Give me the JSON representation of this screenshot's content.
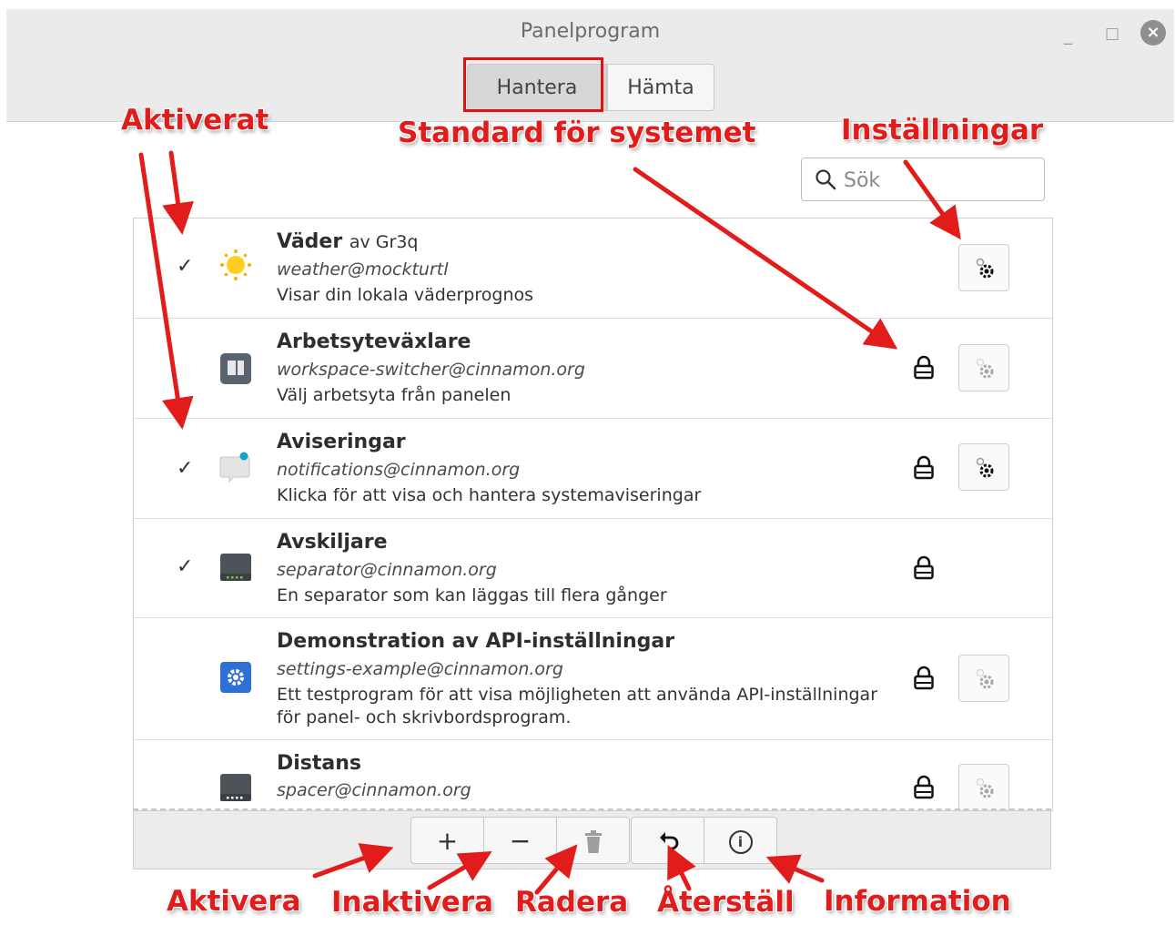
{
  "window": {
    "title": "Panelprogram",
    "minimize": "_",
    "maximize": "□",
    "close": "×"
  },
  "tabs": [
    {
      "label": "Hantera",
      "active": true
    },
    {
      "label": "Hämta",
      "active": false
    }
  ],
  "search": {
    "placeholder": "Sök"
  },
  "applets": [
    {
      "name": "Väder",
      "author": "av Gr3q",
      "uuid": "weather@mockturtl",
      "description": "Visar din lokala väderprognos",
      "enabled": true,
      "system": false,
      "configurable": true,
      "icon": "sun-icon"
    },
    {
      "name": "Arbetsyteväxlare",
      "author": "",
      "uuid": "workspace-switcher@cinnamon.org",
      "description": "Välj arbetsyta från panelen",
      "enabled": false,
      "system": true,
      "configurable": false,
      "icon": "workspace-switcher-icon"
    },
    {
      "name": "Aviseringar",
      "author": "",
      "uuid": "notifications@cinnamon.org",
      "description": "Klicka för att visa och hantera systemaviseringar",
      "enabled": true,
      "system": true,
      "configurable": true,
      "icon": "notification-icon"
    },
    {
      "name": "Avskiljare",
      "author": "",
      "uuid": "separator@cinnamon.org",
      "description": "En separator som kan läggas till flera gånger",
      "enabled": true,
      "system": true,
      "configurable": null,
      "icon": "separator-icon"
    },
    {
      "name": "Demonstration av API-inställningar",
      "author": "",
      "uuid": "settings-example@cinnamon.org",
      "description": "Ett testprogram för att visa möjligheten att använda API-inställningar för panel- och skrivbordsprogram.",
      "enabled": false,
      "system": true,
      "configurable": false,
      "icon": "settings-example-icon"
    },
    {
      "name": "Distans",
      "author": "",
      "uuid": "spacer@cinnamon.org",
      "description": "",
      "enabled": false,
      "system": true,
      "configurable": false,
      "icon": "spacer-icon"
    }
  ],
  "toolbar": {
    "add": "+",
    "remove": "−",
    "delete_icon": "trash-icon",
    "restore_icon": "undo-icon",
    "info": "i"
  },
  "annotations": {
    "aktiverat": "Aktiverat",
    "standard": "Standard för systemet",
    "installningar": "Inställningar",
    "aktivera": "Aktivera",
    "inaktivera": "Inaktivera",
    "radera": "Radera",
    "aterstall": "Återställ",
    "information": "Information"
  },
  "colors": {
    "annotation": "#e21b1b",
    "header_bg": "#ebebeb",
    "active_tab": "#d7d7d7"
  }
}
